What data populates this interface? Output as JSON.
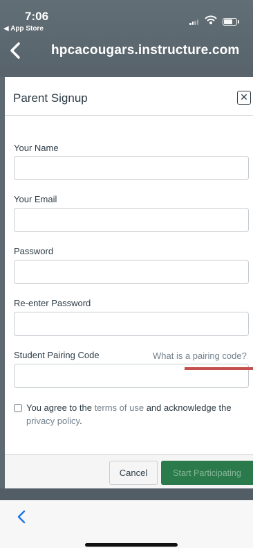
{
  "status_bar": {
    "time": "7:06",
    "back_app": "◀ App Store"
  },
  "nav": {
    "title": "hpcacougars.instructure.com"
  },
  "modal": {
    "title": "Parent Signup",
    "close_glyph": "✕",
    "fields": {
      "name": {
        "label": "Your Name",
        "value": ""
      },
      "email": {
        "label": "Your Email",
        "value": ""
      },
      "password": {
        "label": "Password",
        "value": ""
      },
      "repassword": {
        "label": "Re-enter Password",
        "value": ""
      },
      "pairing": {
        "label": "Student Pairing Code",
        "value": ""
      }
    },
    "pairing_help_link": "What is a pairing code?",
    "agree": {
      "text1": "You agree to the ",
      "terms_link": "terms of use",
      "text2": " and acknowledge the ",
      "privacy_link": "privacy policy",
      "text3": "."
    },
    "buttons": {
      "cancel": "Cancel",
      "start": "Start Participating"
    }
  },
  "colors": {
    "nav_bg": "#5e6a72",
    "text": "#2d3b45",
    "primary_button": "#2b7a4b",
    "link": "#73818c",
    "annotation_red": "#c5514f",
    "back_arrow": "#1a73e8"
  },
  "icons": {
    "nav_back": "chevron-left-icon",
    "bottom_back": "chevron-left-icon",
    "close": "close-icon"
  }
}
